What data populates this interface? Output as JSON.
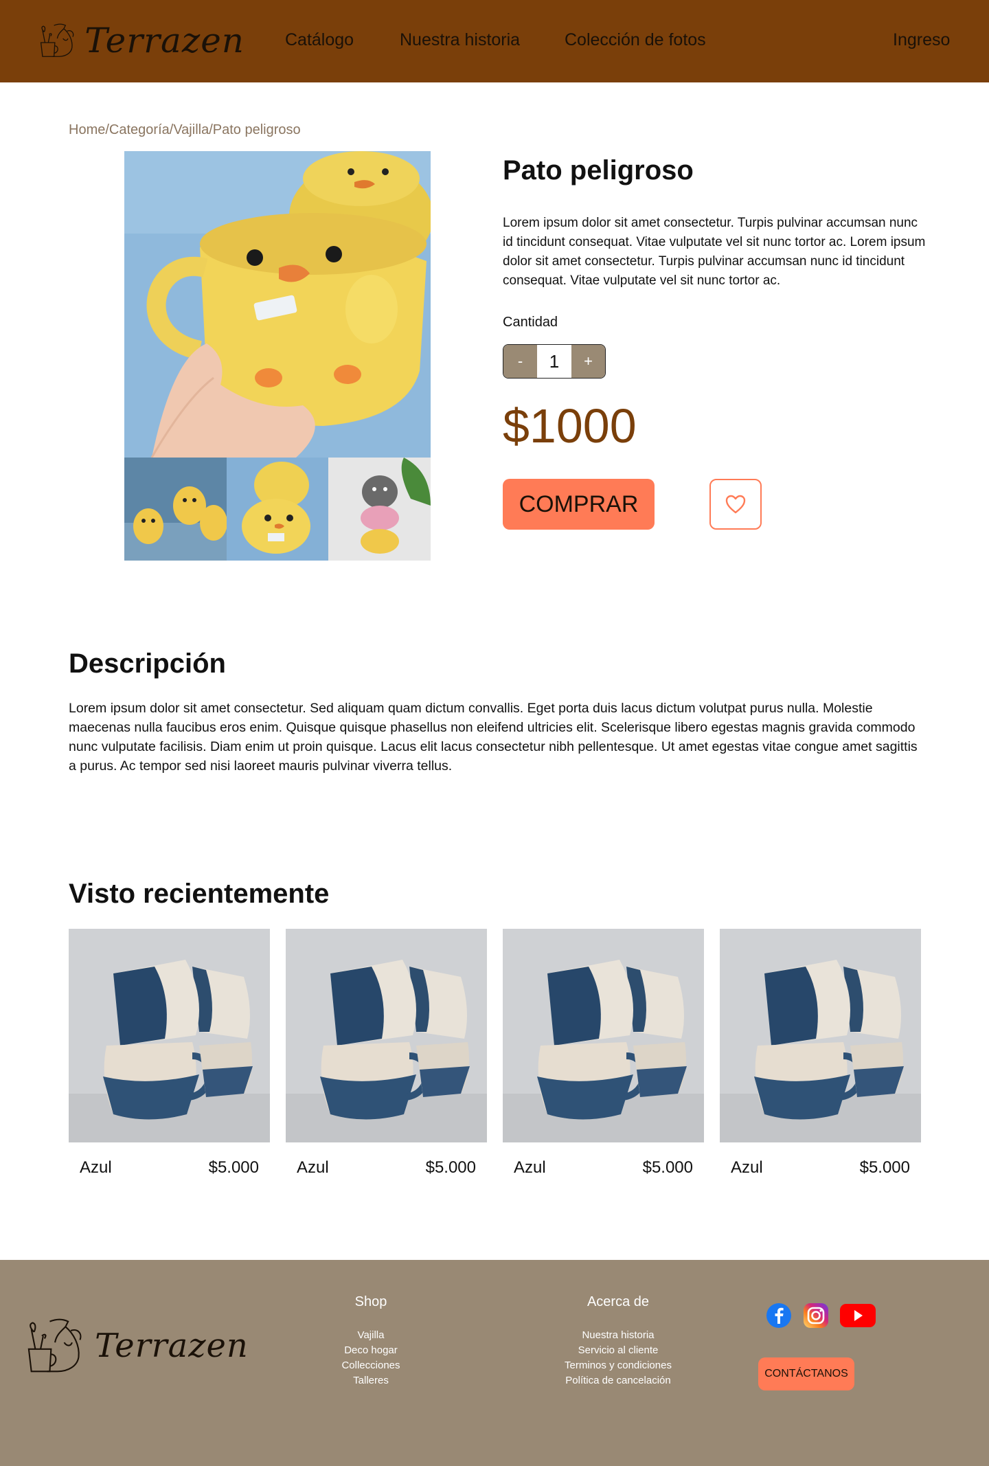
{
  "header": {
    "brand": "Terrazen",
    "nav": {
      "catalog": "Catálogo",
      "history": "Nuestra historia",
      "photos": "Colección de fotos",
      "login": "Ingreso"
    }
  },
  "breadcrumb": {
    "home": "Home",
    "category": "Categoría",
    "subcategory": "Vajilla",
    "current": "Pato peligroso",
    "separator": "/"
  },
  "product": {
    "title": "Pato peligroso",
    "summary": "Lorem ipsum dolor sit amet consectetur. Turpis pulvinar accumsan nunc id tincidunt consequat. Vitae vulputate vel sit nunc tortor ac. Lorem ipsum dolor sit amet consectetur. Turpis pulvinar accumsan nunc id tincidunt consequat. Vitae vulputate vel sit nunc tortor ac.",
    "quantity_label": "Cantidad",
    "quantity": {
      "decrement": "-",
      "value": "1",
      "increment": "+"
    },
    "price": "$1000",
    "buy_label": "COMPRAR",
    "favorite_icon": "heart-icon"
  },
  "description": {
    "title": "Descripción",
    "body": "Lorem ipsum dolor sit amet consectetur. Sed aliquam quam dictum convallis. Eget porta duis lacus dictum volutpat purus nulla. Molestie maecenas nulla faucibus eros enim. Quisque quisque phasellus non eleifend ultricies elit. Scelerisque libero egestas magnis gravida commodo nunc vulputate facilisis. Diam enim ut proin quisque. Lacus elit lacus consectetur nibh pellentesque. Ut amet egestas vitae congue amet sagittis a purus. Ac tempor sed nisi laoreet mauris pulvinar viverra tellus."
  },
  "recent": {
    "title": "Visto recientemente",
    "items": [
      {
        "name": "Azul",
        "price": "$5.000"
      },
      {
        "name": "Azul",
        "price": "$5.000"
      },
      {
        "name": "Azul",
        "price": "$5.000"
      },
      {
        "name": "Azul",
        "price": "$5.000"
      }
    ]
  },
  "footer": {
    "brand": "Terrazen",
    "shop": {
      "heading": "Shop",
      "items": [
        "Vajilla",
        "Deco hogar",
        "Collecciones",
        "Talleres"
      ]
    },
    "about": {
      "heading": "Acerca de",
      "items": [
        "Nuestra historia",
        "Servicio al cliente",
        "Terminos y condiciones",
        "Política de cancelación"
      ]
    },
    "social": [
      "facebook-icon",
      "instagram-icon",
      "youtube-icon"
    ],
    "contact_label": "CONTÁCTANOS"
  },
  "colors": {
    "header_bg": "#7a3f0a",
    "accent": "#ff7b56",
    "footer_bg": "#998974",
    "price": "#7a3f0a",
    "breadcrumb": "#8a7560"
  }
}
